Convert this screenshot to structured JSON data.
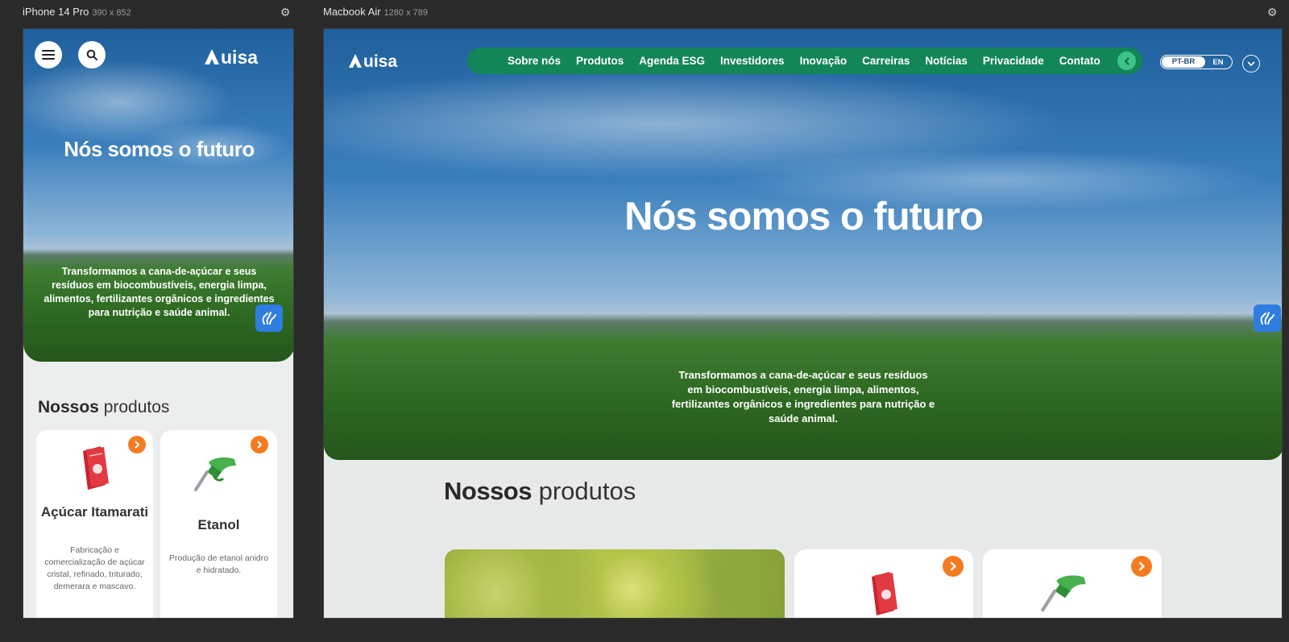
{
  "viewports": {
    "mobile": {
      "name": "iPhone 14 Pro",
      "dims": "390 x 852"
    },
    "desktop": {
      "name": "Macbook Air",
      "dims": "1280 x 789"
    }
  },
  "brand": {
    "logo_text": "AUISA",
    "green": "#138657",
    "accent_orange": "#f47b20",
    "accessibility_blue": "#2e7de0"
  },
  "hero": {
    "title": "Nós somos o futuro",
    "subtitle": "Transformamos a cana-de-açúcar e seus resíduos em biocombustíveis, energia limpa, alimentos, fertilizantes orgânicos e ingredientes para nutrição e saúde animal."
  },
  "nav": {
    "items": [
      "Sobre nós",
      "Produtos",
      "Agenda ESG",
      "Investidores",
      "Inovação",
      "Carreiras",
      "Notícias",
      "Privacidade",
      "Contato"
    ]
  },
  "language": {
    "active": "PT-BR",
    "other": "EN"
  },
  "products": {
    "section_title_bold": "Nossos",
    "section_title_rest": "produtos",
    "items": [
      {
        "title": "Açúcar Itamarati",
        "description": "Fabricação e comercialização de açúcar cristal, refinado, triturado, demerara e mascavo.",
        "icon": "sugar-bag-icon"
      },
      {
        "title": "Etanol",
        "description": "Produção de etanol anidro e hidratado.",
        "icon": "fuel-nozzle-icon"
      }
    ]
  },
  "icons": {
    "menu": "hamburger-icon",
    "search": "search-icon",
    "settings": "gear-icon",
    "accessibility": "sign-language-icon",
    "arrow": "chevron-right-icon",
    "back": "chevron-left-icon",
    "dropdown": "chevron-down-icon"
  }
}
